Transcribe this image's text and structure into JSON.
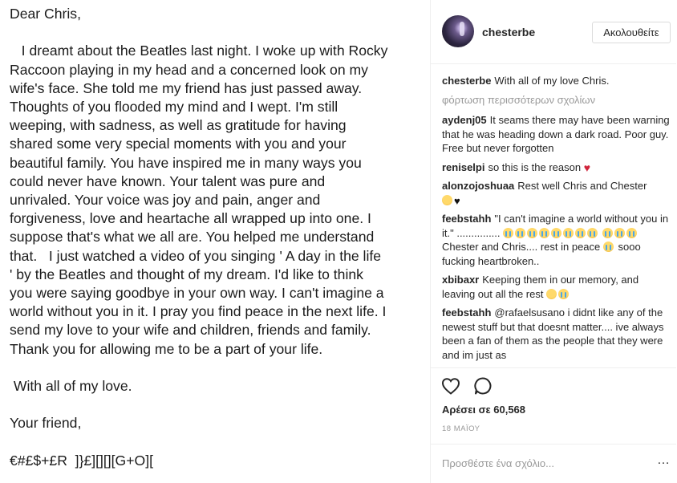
{
  "letter": {
    "text": "Dear Chris,\n\n   I dreamt about the Beatles last night. I woke up with Rocky\nRaccoon playing in my head and a concerned look on my\nwife's face. She told me my friend has just passed away.\nThoughts of you flooded my mind and I wept. I'm still\nweeping, with sadness, as well as gratitude for having\nshared some very special moments with you and your\nbeautiful family. You have inspired me in many ways you\ncould never have known. Your talent was pure and\nunrivaled. Your voice was joy and pain, anger and\nforgiveness, love and heartache all wrapped up into one. I\nsuppose that's what we all are. You helped me understand\nthat.   I just watched a video of you singing ' A day in the life\n' by the Beatles and thought of my dream. I'd like to think\nyou were saying goodbye in your own way. I can't imagine a\nworld without you in it. I pray you find peace in the next life. I\nsend my love to your wife and children, friends and family.\nThank you for allowing me to be a part of your life.\n\n With all of my love.\n\nYour friend,\n\n€#£$+£R  ]}£][][][G+O][",
    "signature": "€#£$+£R  ]}£][][][G+O]["
  },
  "post": {
    "username": "chesterbe",
    "follow_label": "Ακολουθείτε",
    "caption_user": "chesterbe",
    "caption": "With all of my love Chris.",
    "load_more": "φόρτωση περισσότερων σχολίων"
  },
  "comments": [
    {
      "user": "aydenj05",
      "text": "It seams there may have been warning that he was heading down a dark road. Poor guy. Free but never forgotten"
    },
    {
      "user": "reniselpi",
      "text": "so this is the reason",
      "emoji": [
        "heart-red"
      ]
    },
    {
      "user": "alonzojoshuaa",
      "text": "Rest well Chris and Chester",
      "emoji": [
        "sad",
        "heart-black"
      ]
    },
    {
      "user": "feebstahh",
      "text": "\"I can't imagine a world without you in it.\" ...............",
      "text2": "Chester and Chris.... rest in peace",
      "text3": "sooo fucking heartbroken..",
      "emoji": [
        "cry",
        "cry",
        "cry",
        "cry",
        "cry",
        "cry",
        "cry",
        "cry",
        "cry",
        "cry",
        "cry",
        "cry"
      ]
    },
    {
      "user": "xbibaxr",
      "text": "Keeping them in our memory, and leaving out all the rest",
      "emoji": [
        "sad",
        "cry"
      ]
    },
    {
      "user": "feebstahh",
      "text": "@rafaelsusano i didnt like any of the newest stuff but that doesnt matter.... ive always been a fan of them as the people that they were and im just as"
    }
  ],
  "actions": {
    "heart_icon": "heart-outline-icon",
    "comment_icon": "comment-bubble-icon",
    "likes": "Αρέσει σε 60,568",
    "date": "18 ΜΑΪΟΥ"
  },
  "add_comment": {
    "placeholder": "Προσθέστε ένα σχόλιο...",
    "more_label": "…"
  },
  "colors": {
    "text": "#262626",
    "muted": "#999999",
    "border": "#efefef",
    "heart_red": "#d0243b"
  }
}
